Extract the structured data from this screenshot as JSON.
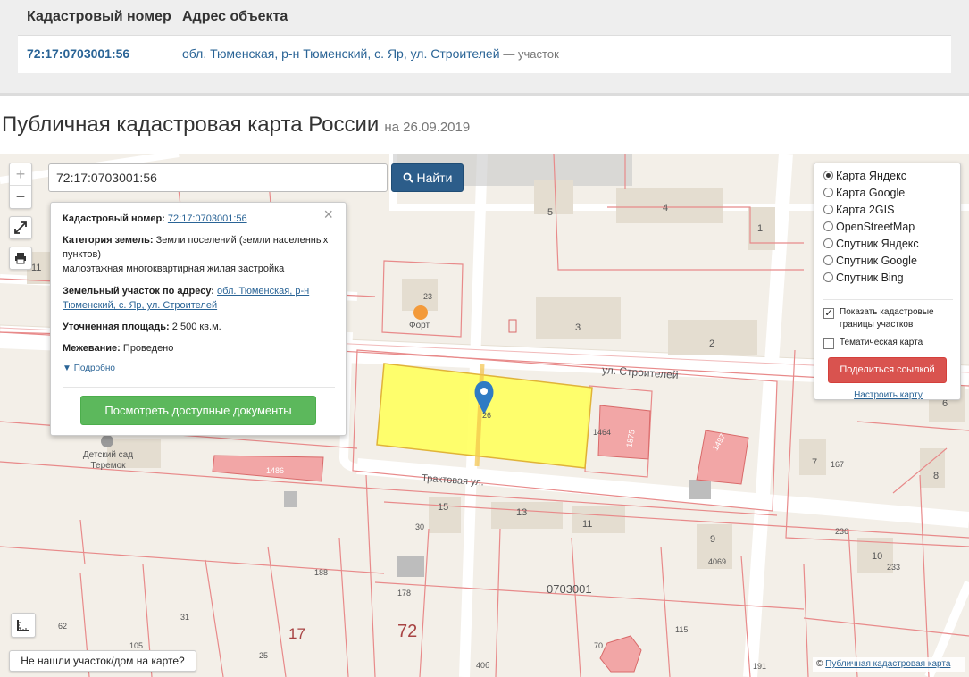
{
  "results_table": {
    "headers": [
      "Кадастровый номер",
      "Адрес объекта"
    ],
    "row": {
      "cadastral_number": "72:17:0703001:56",
      "address": "обл. Тюменская, р-н Тюменский, с. Яр, ул. Строителей",
      "address_suffix": "— участок"
    }
  },
  "page": {
    "title": "Публичная кадастровая карта России",
    "date": "на 26.09.2019"
  },
  "map": {
    "search": {
      "value": "72:17:0703001:56",
      "button_label": "Найти"
    },
    "controls": {
      "zoom_in": "+",
      "zoom_out": "−"
    },
    "info_card": {
      "cadastral_label": "Кадастровый номер:",
      "cadastral_value": "72:17:0703001:56",
      "category_label": "Категория земель:",
      "category_value": "Земли поселений (земли населенных пунктов)",
      "usage_value": "малоэтажная многоквартирная жилая застройка",
      "address_label": "Земельный участок по адресу:",
      "address_value": "обл. Тюменская, р-н Тюменский, с. Яр, ул. Строителей",
      "area_label": "Уточненная площадь:",
      "area_value": "2 500 кв.м.",
      "survey_label": "Межевание:",
      "survey_value": "Проведено",
      "more_link": "Подробно",
      "docs_button": "Посмотреть доступные документы",
      "close": "×"
    },
    "layers": {
      "options": [
        {
          "label": "Карта Яндекс",
          "selected": true
        },
        {
          "label": "Карта Google",
          "selected": false
        },
        {
          "label": "Карта 2GIS",
          "selected": false
        },
        {
          "label": "OpenStreetMap",
          "selected": false
        },
        {
          "label": "Спутник Яндекс",
          "selected": false
        },
        {
          "label": "Спутник Google",
          "selected": false
        },
        {
          "label": "Спутник Bing",
          "selected": false
        }
      ],
      "show_boundaries": {
        "label": "Показать кадастровые границы участков",
        "checked": true
      },
      "thematic": {
        "label": "Тематическая карта",
        "checked": false
      },
      "share_button": "Поделиться ссылкой",
      "settings_link": "Настроить карту"
    },
    "not_found_button": "Не нашли участок/дом на карте?",
    "attribution": {
      "prefix": "©",
      "link": "Публичная кадастровая карта"
    },
    "labels": {
      "street_stroiteley": "ул. Строителей",
      "street_traktovaya": "Трактовая ул.",
      "fort": "Форт",
      "kindergarten": "Детский сад Теремок",
      "quarter": "0703001",
      "region": "72",
      "district": "17",
      "houses": [
        "5",
        "4",
        "1",
        "3",
        "2",
        "23",
        "15",
        "13",
        "11",
        "9",
        "7",
        "8",
        "6",
        "10",
        "30",
        "188",
        "178",
        "31",
        "25",
        "105",
        "62",
        "40б",
        "115",
        "191",
        "70",
        "4069",
        "236",
        "233",
        "167",
        "1464",
        "1875",
        "1486",
        "1497",
        "26",
        "11"
      ]
    }
  }
}
